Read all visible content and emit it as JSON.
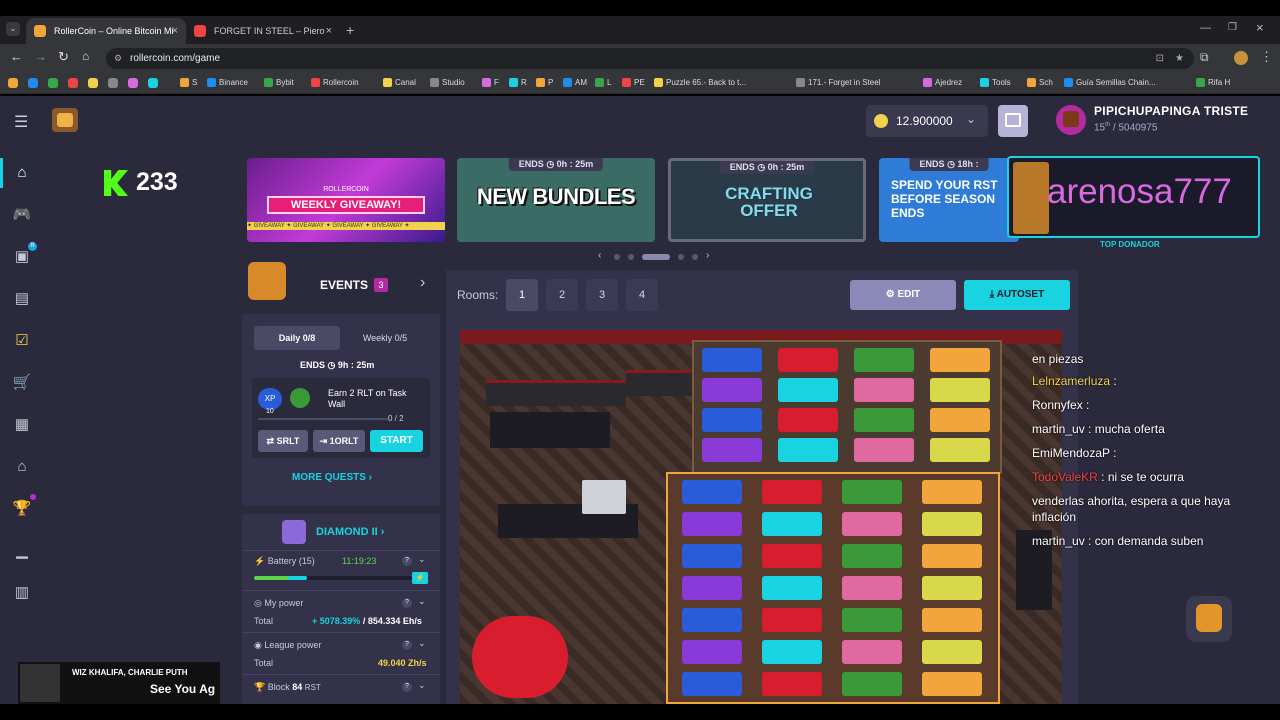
{
  "browser": {
    "tabs": [
      {
        "title": "RollerCoin – Online Bitcoin Mi",
        "active": true
      },
      {
        "title": "FORGET IN STEEL – Piero",
        "active": false
      }
    ],
    "url": "rollercoin.com/game",
    "bookmarks": [
      "S",
      "Binance",
      "Bybit",
      "Rollercoin",
      "Canal",
      "Studio",
      "F",
      "R",
      "P",
      "AM",
      "L",
      "PE",
      "Puzzle 65.- Back to t...",
      "171.- Forget in Steel",
      "Ajedrez",
      "Tools",
      "Sch",
      "Guía Semillas Chain...",
      "Rifa H"
    ]
  },
  "header": {
    "balance": "12.900000",
    "username": "PIPICHUPAPINGA TRISTE",
    "rank": "15",
    "rank_suffix": "th",
    "rank_total": "/ 5040975"
  },
  "stream_overlay": {
    "k_count": "233",
    "donor_name": "arenosa777",
    "donor_label": "TOP DONADOR",
    "music_artist": "WIZ KHALIFA, CHARLIE PUTH",
    "music_title": "See You Ag"
  },
  "banners": [
    {
      "name": "weekly-giveaway",
      "small": "ROLLERCOIN",
      "title": "WEEKLY GIVEAWAY!",
      "ends": ""
    },
    {
      "name": "new-bundles",
      "title": "NEW BUNDLES",
      "ends": "ENDS",
      "time": "0h : 25m"
    },
    {
      "name": "crafting-offer",
      "title": "CRAFTING OFFER",
      "ends": "ENDS",
      "time": "0h : 25m"
    },
    {
      "name": "spend-rst",
      "title": "SPEND YOUR RST BEFORE SEASON ENDS",
      "ends": "ENDS",
      "time": "18h : "
    }
  ],
  "events": {
    "label": "EVENTS",
    "count": "3",
    "tab_daily": "Daily 0/8",
    "tab_weekly": "Weekly 0/5",
    "ends_label": "ENDS",
    "ends_time": "9h : 25m",
    "quest_title": "Earn 2 RLT on Task Wall",
    "quest_xp": "10",
    "quest_progress": "0 / 2",
    "btn_srlt": "SRLT",
    "btn_1orlt": "1ORLT",
    "btn_start": "START",
    "more_quests": "MORE QUESTS"
  },
  "league": {
    "name": "DIAMOND II",
    "battery_label": "Battery (15)",
    "battery_time": "11:19:23",
    "battery_level": 0.33,
    "my_power_label": "My power",
    "total_label": "Total",
    "my_power_pct": "+ 5078.39%",
    "my_power_value": "854.334 Eh/s",
    "league_power_label": "League power",
    "league_total": "49.040 Zh/s",
    "block_label": "Block",
    "block_number": "84",
    "block_unit": "RST"
  },
  "rooms": {
    "label": "Rooms:",
    "items": [
      "1",
      "2",
      "3",
      "4"
    ],
    "edit": "EDIT",
    "autoset": "AUTOSET"
  },
  "chat": [
    {
      "user": "",
      "text": "en piezas"
    },
    {
      "user": "Lelnzamerluza",
      "text": ":"
    },
    {
      "user": "Ronnyfex",
      "text": ":"
    },
    {
      "user": "martin_uv",
      "text": ": mucha oferta"
    },
    {
      "user": "EmiMendozaP",
      "text": ":"
    },
    {
      "user": "TodoValeKR",
      "text": ": ni se te ocurra"
    },
    {
      "user": "",
      "text": "venderlas ahorita, espera a que haya"
    },
    {
      "user": "",
      "text": "inflación"
    },
    {
      "user": "martin_uv",
      "text": ": con demanda suben"
    }
  ],
  "colors": {
    "accent_cyan": "#19d3e0",
    "accent_purple": "#b24bd8",
    "green": "#5bd84a",
    "yellow": "#f2d24a"
  }
}
